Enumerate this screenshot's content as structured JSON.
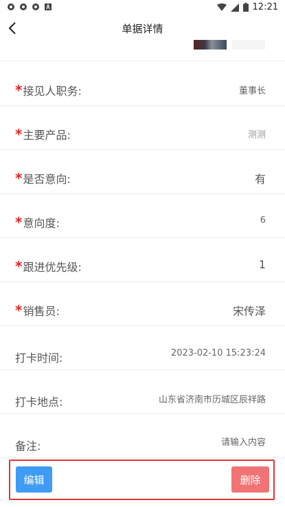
{
  "status_bar": {
    "time": "12:21",
    "left_icons": [
      "settings-icon",
      "settings-icon",
      "settings-icon",
      "font-icon"
    ],
    "right_icons": [
      "wifi-icon",
      "signal-icon",
      "battery-icon"
    ]
  },
  "nav": {
    "title": "单据详情",
    "back_icon": "back-arrow-icon"
  },
  "fields": [
    {
      "label": "接见人职务:",
      "value": "董事长",
      "required": true
    },
    {
      "label": "主要产品:",
      "value": "测测",
      "required": true
    },
    {
      "label": "是否意向:",
      "value": "有",
      "required": true
    },
    {
      "label": "意向度:",
      "value": "6",
      "required": true
    },
    {
      "label": "跟进优先级:",
      "value": "1",
      "required": true
    },
    {
      "label": "销售员:",
      "value": "宋传泽",
      "required": true
    },
    {
      "label": "打卡时间:",
      "value": "2023-02-10 15:23:24",
      "required": false
    },
    {
      "label": "打卡地点:",
      "value": "山东省济南市历城区辰祥路",
      "required": false
    },
    {
      "label": "备注:",
      "value": "请输入内容",
      "required": false
    }
  ],
  "required_mark": "*",
  "actions": {
    "edit_label": "编辑",
    "delete_label": "删除",
    "edit_color": "#3f9cf4",
    "delete_color": "#f07476",
    "highlight_color": "#e23434"
  }
}
